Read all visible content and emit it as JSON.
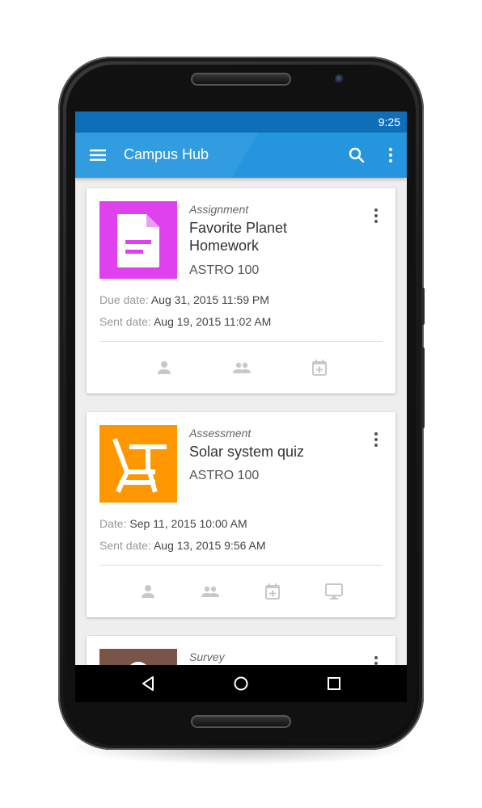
{
  "status": {
    "time": "9:25"
  },
  "app": {
    "title": "Campus Hub"
  },
  "colors": {
    "primary": "#2596de",
    "status_bar": "#0e6eb8",
    "assignment": "#e041ef",
    "assessment": "#ff9800",
    "survey": "#795548"
  },
  "icons": {
    "menu": "menu-icon",
    "search": "search-icon",
    "more": "more-vert-icon",
    "back": "back-icon",
    "home": "home-icon",
    "recents": "recents-icon"
  },
  "cards": [
    {
      "type": "Assignment",
      "title": "Favorite Planet Homework",
      "course": "ASTRO 100",
      "due_label": "Due date:",
      "due_value": "Aug 31, 2015 11:59 PM",
      "sent_label": "Sent date:",
      "sent_value": "Aug 19, 2015 11:02 AM",
      "thumb_icon": "document-icon",
      "actions": [
        "person-icon",
        "group-icon",
        "calendar-add-icon"
      ]
    },
    {
      "type": "Assessment",
      "title": "Solar system quiz",
      "course": "ASTRO 100",
      "due_label": "Date:",
      "due_value": "Sep 11, 2015 10:00 AM",
      "sent_label": "Sent date:",
      "sent_value": "Aug 13, 2015 9:56 AM",
      "thumb_icon": "desk-icon",
      "actions": [
        "person-icon",
        "group-icon",
        "calendar-add-icon",
        "monitor-icon"
      ]
    },
    {
      "type": "Survey",
      "thumb_icon": "person-icon"
    }
  ]
}
